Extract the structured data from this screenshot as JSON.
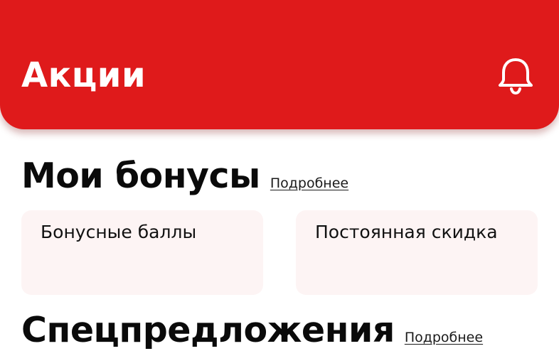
{
  "header": {
    "title": "Акции",
    "background_color": "#df1a1b",
    "notification_icon": "bell-icon"
  },
  "bonuses": {
    "title": "Мои бонусы",
    "more_label": "Подробнее",
    "cards": [
      {
        "label": "Бонусные баллы"
      },
      {
        "label": "Постоянная скидка"
      }
    ],
    "card_background": "#fdf4f4"
  },
  "special_offers": {
    "title": "Спецпредложения",
    "more_label": "Подробнее"
  }
}
